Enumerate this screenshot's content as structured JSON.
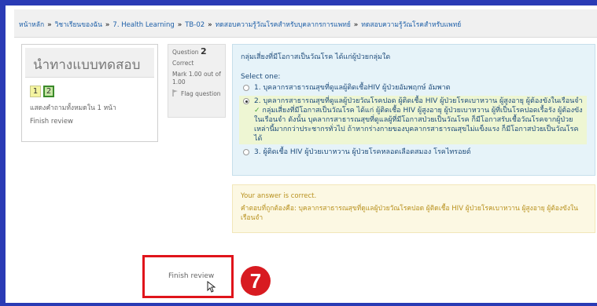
{
  "breadcrumb": {
    "items": [
      "หน้าหลัก",
      "วิชาเรียนของฉัน",
      "7. Health Learning",
      "TB-02",
      "ทดสอบความรู้วัณโรคสำหรับบุคลากรการแพทย์",
      "ทดสอบความรู้วัณโรคสำหรับแพทย์"
    ],
    "separator": "»"
  },
  "quiz_nav": {
    "title": "นำทางแบบทดสอบ",
    "questions": [
      "1",
      "2"
    ],
    "show_all": "แสดงคำถามทั้งหมดใน 1 หน้า",
    "finish_review": "Finish review"
  },
  "question_info": {
    "question_label": "Question",
    "number": "2",
    "state": "Correct",
    "mark": "Mark 1.00 out of 1.00",
    "flag": "Flag question",
    "flag_icon": "flag-icon"
  },
  "question": {
    "text": "กลุ่มเสี่ยงที่มีโอกาสเป็นวัณโรค ได้แก่ผู้ป่วยกลุ่มใด",
    "select_one": "Select one:",
    "answers": [
      {
        "label": "1. บุคลากรสาธารณสุขที่ดูแลผู้ติดเชื้อHIV ผู้ป่วยอัมพฤกษ์ อัมพาต",
        "checked": false
      },
      {
        "label": "2. บุคลากรสาธารณสุขที่ดูแลผู้ป่วยวัณโรคปอด ผู้ติดเชื้อ HIV ผู้ป่วยโรคเบาหวาน ผู้สูงอายุ ผู้ต้องขังในเรือนจำ",
        "checked": true,
        "feedback": "กลุ่มเสี่ยงที่มีโอกาสเป็นวัณโรค ได้แก่ ผู้ติดเชื้อ HIV ผู้สูงอายุ ผู้ป่วยเบาหวาน ผู้ที่เป็นโรคปอดเรื้อรัง ผู้ต้องขังในเรือนจำ ดังนั้น บุคลากรสาธารณสุขที่ดูแลผู้ที่มีโอกาสป่วยเป็นวัณโรค ก็มีโอกาสรับเชื้อวัณโรคจากผู้ป่วยเหล่านี้มากกว่าประชากรทั่วไป ถ้าหากร่างกายของบุคลากรสาธารณสุขไม่แข็งแรง ก็มีโอกาสป่วยเป็นวัณโรคได้"
      },
      {
        "label": "3. ผู้ติดเชื้อ HIV ผู้ป่วยเบาหวาน ผู้ป่วยโรคหลอดเลือดสมอง โรคไทรอยด์",
        "checked": false
      }
    ]
  },
  "feedback": {
    "status": "Your answer is correct.",
    "right_answer": "คำตอบที่ถูกต้องคือ: บุคลากรสาธารณสุขที่ดูแลผู้ป่วยวัณโรคปอด ผู้ติดเชื้อ HIV ผู้ป่วยโรคเบาหวาน ผู้สูงอายุ ผู้ต้องขังในเรือนจำ"
  },
  "finish_button": {
    "label": "Finish review"
  },
  "annotation": {
    "step": "7"
  },
  "colors": {
    "frame": "#2a3bb5",
    "highlight_border": "#e0141b",
    "badge": "#d81b21",
    "question_bg": "#e6f3f9",
    "feedback_bg": "#fcf8e3"
  }
}
